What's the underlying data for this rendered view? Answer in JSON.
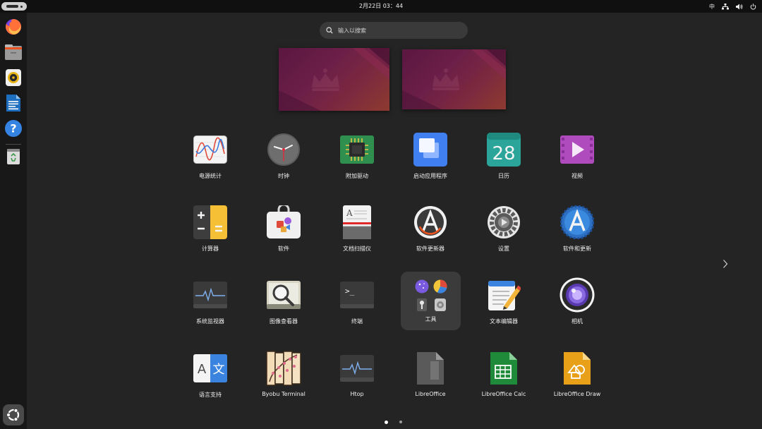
{
  "topbar": {
    "clock": "2月22日  03：44",
    "input_method": "中"
  },
  "dock": {
    "items": [
      "firefox",
      "files",
      "rhythmbox",
      "libreoffice-writer",
      "help",
      "trash"
    ]
  },
  "search": {
    "placeholder": "输入以搜索"
  },
  "apps": [
    {
      "label": "电源统计",
      "icon": "power-statistics-icon"
    },
    {
      "label": "时钟",
      "icon": "clock-icon"
    },
    {
      "label": "附加驱动",
      "icon": "chip-icon"
    },
    {
      "label": "启动应用程序",
      "icon": "startup-apps-icon"
    },
    {
      "label": "日历",
      "icon": "calendar-icon",
      "day": "28"
    },
    {
      "label": "视频",
      "icon": "video-icon"
    },
    {
      "label": "计算器",
      "icon": "calculator-icon"
    },
    {
      "label": "软件",
      "icon": "software-icon"
    },
    {
      "label": "文档扫描仪",
      "icon": "document-scanner-icon"
    },
    {
      "label": "软件更新器",
      "icon": "software-updater-icon"
    },
    {
      "label": "设置",
      "icon": "settings-gear-icon"
    },
    {
      "label": "软件和更新",
      "icon": "software-updates-icon"
    },
    {
      "label": "系统监视器",
      "icon": "system-monitor-icon"
    },
    {
      "label": "图像查看器",
      "icon": "image-viewer-icon"
    },
    {
      "label": "终端",
      "icon": "terminal-icon",
      "prompt": ">_"
    },
    {
      "label": "工具",
      "icon": "utilities-folder-icon"
    },
    {
      "label": "文本编辑器",
      "icon": "text-editor-icon"
    },
    {
      "label": "相机",
      "icon": "camera-icon"
    },
    {
      "label": "语言支持",
      "icon": "language-support-icon",
      "glyph_a": "A",
      "glyph_b": "文"
    },
    {
      "label": "Byobu Terminal",
      "icon": "byobu-icon"
    },
    {
      "label": "Htop",
      "icon": "htop-icon"
    },
    {
      "label": "LibreOffice",
      "icon": "libreoffice-icon"
    },
    {
      "label": "LibreOffice Calc",
      "icon": "libreoffice-calc-icon"
    },
    {
      "label": "LibreOffice Draw",
      "icon": "libreoffice-draw-icon"
    }
  ],
  "pager": {
    "current": 1,
    "total": 2
  },
  "colors": {
    "background": "#242424",
    "topbar": "#101010",
    "dock": "#181818",
    "accent_orange": "#e95420"
  }
}
